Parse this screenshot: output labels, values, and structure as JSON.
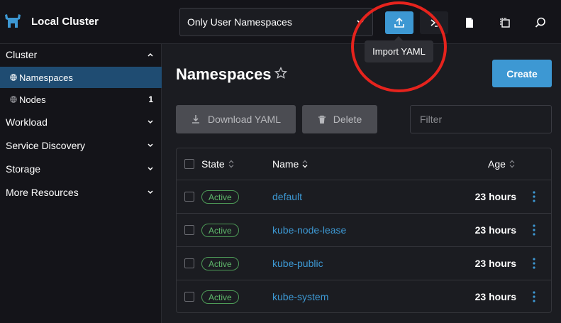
{
  "header": {
    "cluster_name": "Local Cluster",
    "namespace_filter": "Only User Namespaces",
    "buttons": [
      {
        "name": "import-yaml",
        "icon": "upload-icon"
      },
      {
        "name": "kubectl-shell",
        "icon": "terminal-icon"
      },
      {
        "name": "kubeconfig",
        "icon": "file-icon"
      },
      {
        "name": "copy-kubeconfig",
        "icon": "copy-icon"
      },
      {
        "name": "search",
        "icon": "search-icon"
      }
    ],
    "tooltip": "Import YAML"
  },
  "sidebar": {
    "groups": [
      {
        "label": "Cluster",
        "expanded": true
      },
      {
        "label": "Workload",
        "expanded": false
      },
      {
        "label": "Service Discovery",
        "expanded": false
      },
      {
        "label": "Storage",
        "expanded": false
      },
      {
        "label": "More Resources",
        "expanded": false
      }
    ],
    "items": [
      {
        "label": "Namespaces",
        "count": "",
        "active": true
      },
      {
        "label": "Nodes",
        "count": "1",
        "active": false
      }
    ]
  },
  "main": {
    "title": "Namespaces",
    "create_label": "Create",
    "download_label": "Download YAML",
    "delete_label": "Delete",
    "filter_placeholder": "Filter",
    "columns": [
      "State",
      "Name",
      "Age"
    ],
    "rows": [
      {
        "state": "Active",
        "name": "default",
        "age": "23 hours"
      },
      {
        "state": "Active",
        "name": "kube-node-lease",
        "age": "23 hours"
      },
      {
        "state": "Active",
        "name": "kube-public",
        "age": "23 hours"
      },
      {
        "state": "Active",
        "name": "kube-system",
        "age": "23 hours"
      }
    ]
  },
  "colors": {
    "accent": "#3d98d3",
    "sidebar_active": "#1f4c72",
    "status_active": "#5fb86b",
    "annotation": "#e6231d"
  }
}
